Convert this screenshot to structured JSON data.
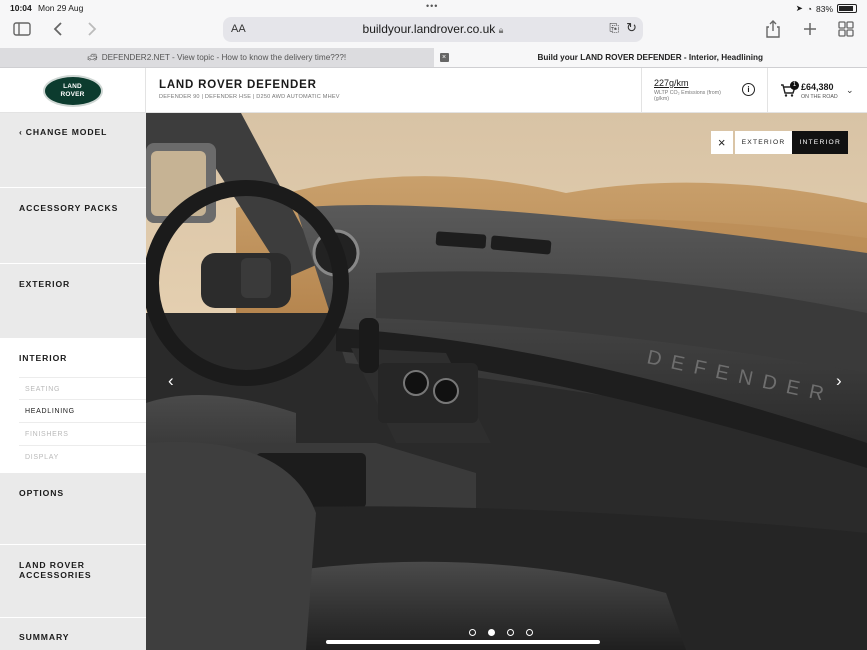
{
  "status": {
    "time": "10:04",
    "date": "Mon 29 Aug",
    "battery": "83%"
  },
  "browser": {
    "url_aa": "AA",
    "url": "buildyour.landrover.co.uk",
    "tabs": [
      {
        "label": "DEFENDER2.NET - View topic - How to know the delivery time???!",
        "active": false
      },
      {
        "label": "Build your LAND ROVER DEFENDER - Interior, Headlining",
        "active": true
      }
    ],
    "close_glyph": "×"
  },
  "header": {
    "logo_line1": "LAND",
    "logo_line2": "ROVER",
    "title": "LAND ROVER DEFENDER",
    "subtitle": "DEFENDER 90 | DEFENDER HSE | D250 AWD AUTOMATIC MHEV",
    "emissions_value": "227g/km",
    "emissions_label": "WLTP CO₂ Emissions (from) (g/km)",
    "info_glyph": "i",
    "cart_count": "1",
    "price": "£64,380",
    "price_label": "ON THE ROAD"
  },
  "sidebar": {
    "change_model": "CHANGE MODEL",
    "sections": [
      {
        "label": "ACCESSORY PACKS"
      },
      {
        "label": "EXTERIOR"
      },
      {
        "label": "INTERIOR"
      },
      {
        "label": "OPTIONS"
      },
      {
        "label": "LAND ROVER ACCESSORIES"
      },
      {
        "label": "SUMMARY"
      }
    ],
    "interior_items": [
      "SEATING",
      "HEADLINING",
      "FINISHERS",
      "DISPLAY"
    ]
  },
  "viewer": {
    "exterior_label": "EXTERIOR",
    "interior_label": "INTERIOR",
    "active_view": "INTERIOR",
    "slide_count": 4,
    "active_slide": 2,
    "dash_text": "DEFENDER"
  }
}
